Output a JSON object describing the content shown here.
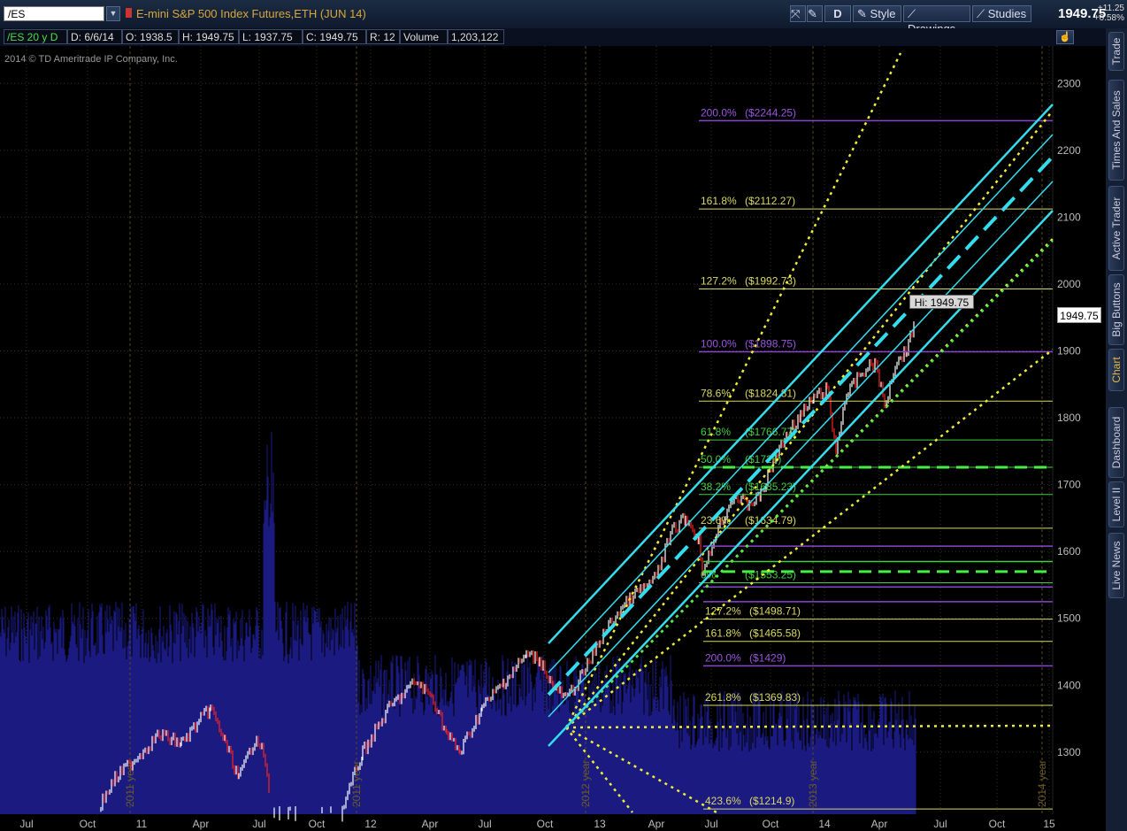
{
  "header": {
    "symbol": "/ES",
    "instrument_title": "E-mini S&P 500 Index Futures,ETH (JUN 14)",
    "toolbar": {
      "drawing_mode": "D",
      "style_label": "Style",
      "drawings_label": "Drawings",
      "studies_label": "Studies"
    },
    "last_price": "1949.75",
    "net_change": "+11.25",
    "percent_change": "+0.58%"
  },
  "info_bar": {
    "period": "/ES 20 y D",
    "date": "D: 6/6/14",
    "open": "O: 1938.5",
    "high": "H: 1949.75",
    "low": "L: 1937.75",
    "close": "C: 1949.75",
    "range": "R: 12",
    "volume_label": "Volume",
    "volume": "1,203,122"
  },
  "copyright": "2014 © TD Ameritrade IP Company, Inc.",
  "price_axis": [
    "2300",
    "2200",
    "2100",
    "2000",
    "1900",
    "1800",
    "1700",
    "1600",
    "1500",
    "1400",
    "1300"
  ],
  "price_tag": "1949.75",
  "hi_label": "Hi: 1949.75",
  "time_axis": [
    "Jul",
    "Oct",
    "11",
    "Apr",
    "Jul",
    "Oct",
    "12",
    "Apr",
    "Jul",
    "Oct",
    "13",
    "Apr",
    "Jul",
    "Oct",
    "14",
    "Apr",
    "Jul",
    "Oct",
    "15"
  ],
  "year_marks": [
    "2011 year",
    "2011 year",
    "2012 year",
    "2013 year",
    "2014 year"
  ],
  "fib_levels": [
    {
      "pct": "200.0%",
      "val": "($2244.25)",
      "price": 2244.25,
      "color": "#8844cc"
    },
    {
      "pct": "161.8%",
      "val": "($2112.27)",
      "price": 2112.27,
      "color": "#d8d860"
    },
    {
      "pct": "127.2%",
      "val": "($1992.73)",
      "price": 1992.73,
      "color": "#d8d860"
    },
    {
      "pct": "100.0%",
      "val": "($1898.75)",
      "price": 1898.75,
      "color": "#8844cc"
    },
    {
      "pct": "78.6%",
      "val": "($1824.81)",
      "price": 1824.81,
      "color": "#d8d860"
    },
    {
      "pct": "61.8%",
      "val": "($1766.77)",
      "price": 1766.77,
      "color": "#44cc44"
    },
    {
      "pct": "50.0%",
      "val": "($1726)",
      "price": 1726,
      "color": "#44cc44"
    },
    {
      "pct": "38.2%",
      "val": "($1685.23)",
      "price": 1685.23,
      "color": "#44cc44"
    },
    {
      "pct": "23.6%",
      "val": "($1634.79)",
      "price": 1634.79,
      "color": "#d8d860"
    },
    {
      "pct": "0%",
      "val": "($1553.25)",
      "price": 1553.25,
      "color": "#44cc44"
    },
    {
      "pct": "127.2%",
      "val": "($1498.71)",
      "price": 1498.71,
      "color": "#d8d860"
    },
    {
      "pct": "161.8%",
      "val": "($1465.58)",
      "price": 1465.58,
      "color": "#d8d860"
    },
    {
      "pct": "200.0%",
      "val": "($1429)",
      "price": 1429,
      "color": "#8844cc"
    },
    {
      "pct": "261.8%",
      "val": "($1369.83)",
      "price": 1369.83,
      "color": "#d8d860"
    },
    {
      "pct": "423.6%",
      "val": "($1214.9)",
      "price": 1214.9,
      "color": "#d8d860"
    }
  ],
  "right_tabs": [
    "Trade",
    "Times And Sales",
    "Active Trader",
    "Big Buttons",
    "Chart",
    "Dashboard",
    "Level II",
    "Live News"
  ],
  "active_tab": "Chart",
  "colors": {
    "up": "#ffffff",
    "down": "#ff2222",
    "volume": "#1a1a80",
    "channel": "#33ddee",
    "fan": "#eeee33"
  }
}
